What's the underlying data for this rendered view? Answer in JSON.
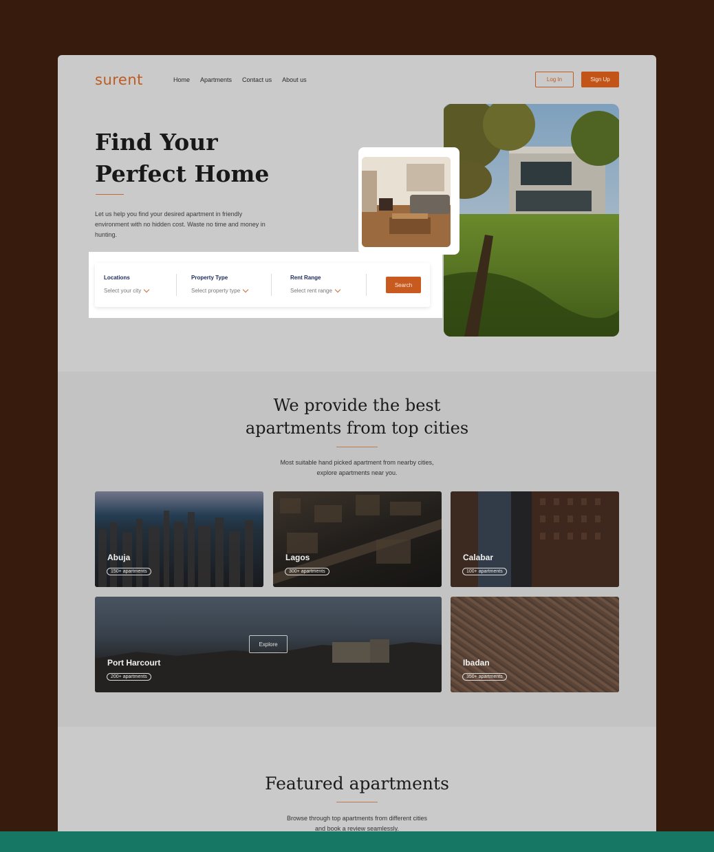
{
  "brand": {
    "logo": "surent"
  },
  "nav": [
    "Home",
    "Apartments",
    "Contact us",
    "About us"
  ],
  "auth": {
    "login": "Log In",
    "signup": "Sign Up"
  },
  "hero": {
    "title_line1": "Find Your",
    "title_line2": "Perfect Home",
    "description": "Let us help you find your desired apartment in friendly environment with no hidden cost. Waste no time and money in hunting."
  },
  "search": {
    "fields": [
      {
        "label": "Locations",
        "placeholder": "Select your city"
      },
      {
        "label": "Property Type",
        "placeholder": "Select property type"
      },
      {
        "label": "Rent Range",
        "placeholder": "Select rent range"
      }
    ],
    "button": "Search"
  },
  "cities_section": {
    "title_line1": "We provide the best",
    "title_line2": "apartments from top cities",
    "desc_line1": "Most suitable hand picked apartment from nearby cities,",
    "desc_line2": "explore apartments near you.",
    "cities": [
      {
        "name": "Abuja",
        "count": "150+ apartments"
      },
      {
        "name": "Lagos",
        "count": "300+ apartments"
      },
      {
        "name": "Calabar",
        "count": "100+ apartments"
      },
      {
        "name": "Port Harcourt",
        "count": "200+ apartments",
        "action": "Explore"
      },
      {
        "name": "Ibadan",
        "count": "350+ apartments"
      }
    ]
  },
  "featured": {
    "title": "Featured apartments",
    "desc_line1": "Browse through top apartments from different cities",
    "desc_line2": "and book a review seamlessly."
  },
  "colors": {
    "accent": "#c35417",
    "page_bg": "#371c0e",
    "bottom_bar": "#177765"
  }
}
